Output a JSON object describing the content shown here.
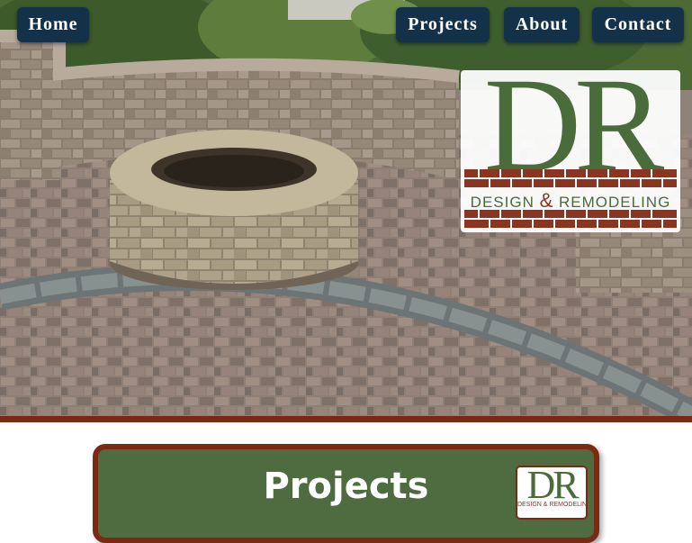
{
  "nav": {
    "home": "Home",
    "projects": "Projects",
    "about": "About",
    "contact": "Contact"
  },
  "logo": {
    "letters": "DR",
    "tagline_left": "DESIGN",
    "tagline_amp": "&",
    "tagline_right": "REMODELING"
  },
  "section": {
    "title": "Projects"
  },
  "colors": {
    "nav_bg": "#13324a",
    "brand_green": "#4a6b3a",
    "brand_brick": "#8a3422",
    "accent_rule": "#7a2a12",
    "panel_bg": "#4f6b40"
  },
  "icons": {
    "hero_image": "paver-patio-fire-pit-photo",
    "logo": "dr-brick-logo"
  }
}
